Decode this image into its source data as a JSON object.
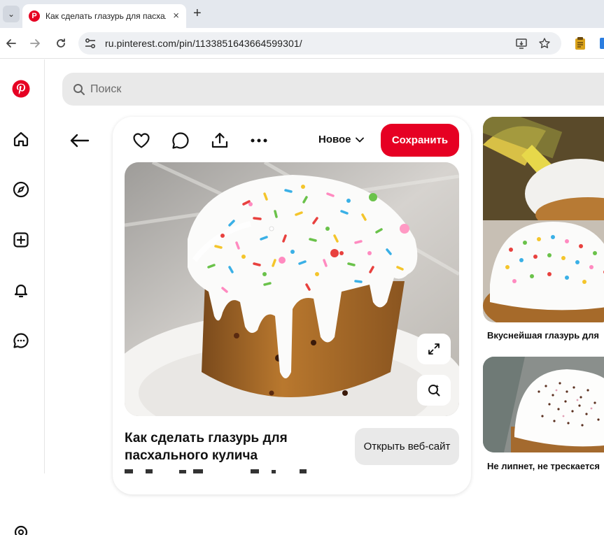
{
  "browser": {
    "tab_title": "Как сделать глазурь для пасхального кулича",
    "tab_favicon": "P",
    "new_tab_label": "+",
    "close_tab_label": "×",
    "tab_menu_label": "⌄",
    "url": "ru.pinterest.com/pin/1133851643664599301/"
  },
  "icons": {
    "back": "arrow-left-icon",
    "forward": "arrow-right-icon",
    "reload": "reload-icon",
    "site_info": "tune-icon",
    "install": "install-app-icon",
    "bookmark": "star-icon",
    "extension1": "clipboard-extension-icon",
    "extension2": "blue-extension-icon"
  },
  "rail": {
    "items": [
      "pinterest-logo",
      "home-icon",
      "explore-icon",
      "create-icon",
      "notifications-icon",
      "messages-icon",
      "settings-icon"
    ]
  },
  "search": {
    "placeholder": "Поиск"
  },
  "pin": {
    "board_label": "Новое",
    "save_label": "Сохранить",
    "title": "Как сделать глазурь для пасхального кулича",
    "visit_label": "Открыть веб-сайт"
  },
  "related": [
    {
      "title": "Вкуснейшая глазурь для"
    },
    {
      "title": "Не липнет, не трескается"
    }
  ],
  "colors": {
    "brand_red": "#e60023",
    "search_bg": "#e9e9e9",
    "url_underline": "#d4141f"
  }
}
